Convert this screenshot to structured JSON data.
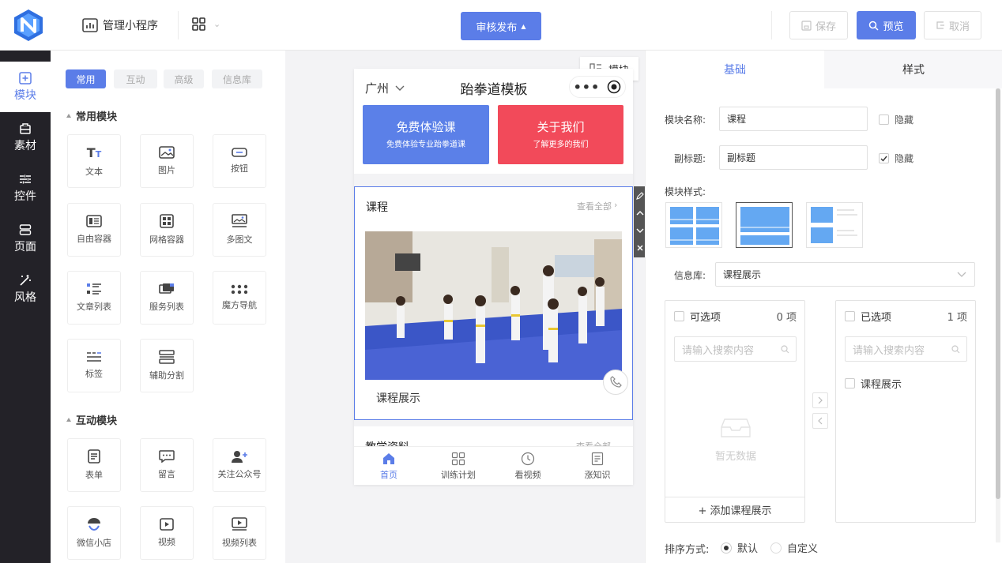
{
  "topbar": {
    "manage_label": "管理小程序",
    "publish_label": "审核发布",
    "save_label": "保存",
    "preview_label": "预览",
    "cancel_label": "取消"
  },
  "rail": [
    {
      "label": "模块",
      "icon": "plus-square-icon",
      "active": true
    },
    {
      "label": "素材",
      "icon": "material-icon"
    },
    {
      "label": "控件",
      "icon": "sliders-icon"
    },
    {
      "label": "页面",
      "icon": "pages-icon"
    },
    {
      "label": "风格",
      "icon": "magic-wand-icon"
    }
  ],
  "panel": {
    "chips": [
      "常用",
      "互动",
      "高级",
      "信息库"
    ],
    "section_common": "常用模块",
    "section_interact": "互动模块",
    "common_modules": [
      "文本",
      "图片",
      "按钮",
      "自由容器",
      "网格容器",
      "多图文",
      "文章列表",
      "服务列表",
      "魔方导航",
      "标签",
      "辅助分割"
    ],
    "interact_modules": [
      "表单",
      "留言",
      "关注公众号",
      "微信小店",
      "视频",
      "视频列表"
    ]
  },
  "canvas": {
    "module_tag": "模块",
    "phone": {
      "city": "广州",
      "title": "跆拳道模板",
      "card1_title": "免费体验课",
      "card1_sub": "免费体验专业跆拳道课",
      "card2_title": "关于我们",
      "card2_sub": "了解更多的我们",
      "course_title": "课程",
      "view_all": "查看全部",
      "course_caption": "课程展示",
      "next_title": "教学资料",
      "nav": [
        "首页",
        "训练计划",
        "看视频",
        "涨知识"
      ]
    }
  },
  "settings": {
    "tab_basic": "基础",
    "tab_style": "样式",
    "name_label": "模块名称:",
    "name_value": "课程",
    "hide_label": "隐藏",
    "subtitle_label": "副标题:",
    "subtitle_value": "副标题",
    "style_label": "模块样式:",
    "library_label": "信息库:",
    "library_value": "课程展示",
    "left_box": {
      "title": "可选项",
      "count": "0 项",
      "placeholder": "请输入搜索内容",
      "empty": "暂无数据",
      "add": "+ 添加课程展示"
    },
    "right_box": {
      "title": "已选项",
      "count": "1 项",
      "placeholder": "请输入搜索内容",
      "item": "课程展示"
    },
    "sort_label": "排序方式:",
    "sort_default": "默认",
    "sort_custom": "自定义"
  },
  "colors": {
    "accent": "#5b7de8",
    "rail": "#232228",
    "card_blue": "#5b80e8",
    "card_red": "#f24a5a"
  }
}
